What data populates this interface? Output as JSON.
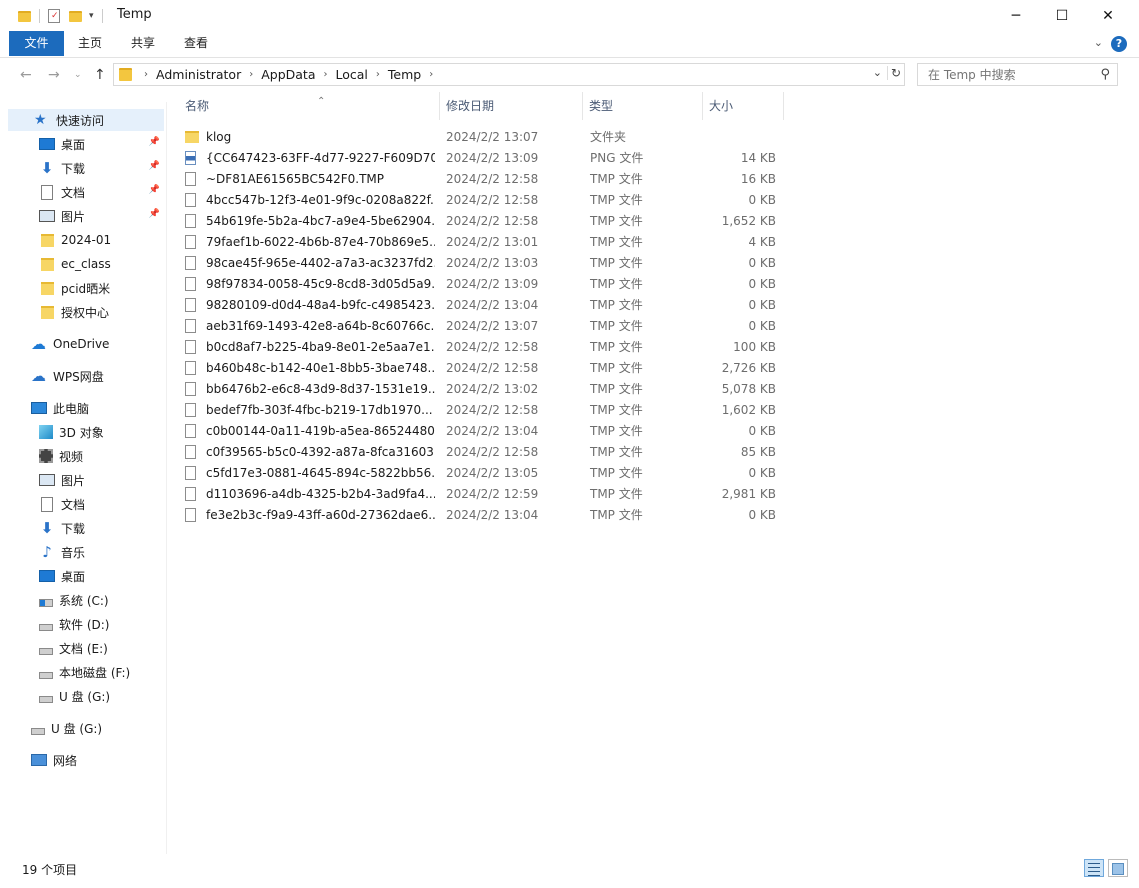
{
  "window": {
    "title": "Temp",
    "controls": {
      "minimize": "─",
      "maximize": "☐",
      "close": "✕"
    }
  },
  "ribbon": {
    "tabs": [
      "文件",
      "主页",
      "共享",
      "查看"
    ],
    "help": "?"
  },
  "address": {
    "crumbs": [
      "Administrator",
      "AppData",
      "Local",
      "Temp"
    ]
  },
  "search": {
    "placeholder": "在 Temp 中搜索"
  },
  "sidebar": {
    "quick_access": "快速访问",
    "quick_items": [
      {
        "label": "桌面",
        "icon": "desktop-icon",
        "pinned": true
      },
      {
        "label": "下载",
        "icon": "download-icon",
        "pinned": true
      },
      {
        "label": "文档",
        "icon": "document-icon",
        "pinned": true
      },
      {
        "label": "图片",
        "icon": "pictures-icon",
        "pinned": true
      },
      {
        "label": "2024-01",
        "icon": "folder-icon",
        "pinned": false
      },
      {
        "label": "ec_class",
        "icon": "folder-icon",
        "pinned": false
      },
      {
        "label": "pcid晒米",
        "icon": "folder-icon",
        "pinned": false
      },
      {
        "label": "授权中心",
        "icon": "folder-icon",
        "pinned": false
      }
    ],
    "onedrive": "OneDrive",
    "wps": "WPS网盘",
    "this_pc": "此电脑",
    "pc_items": [
      {
        "label": "3D 对象",
        "icon": "3d-objects-icon"
      },
      {
        "label": "视频",
        "icon": "video-icon"
      },
      {
        "label": "图片",
        "icon": "pictures-icon"
      },
      {
        "label": "文档",
        "icon": "document-icon"
      },
      {
        "label": "下载",
        "icon": "download-icon"
      },
      {
        "label": "音乐",
        "icon": "music-icon"
      },
      {
        "label": "桌面",
        "icon": "desktop-icon"
      },
      {
        "label": "系统 (C:)",
        "icon": "system-drive-icon"
      },
      {
        "label": "软件 (D:)",
        "icon": "drive-icon"
      },
      {
        "label": "文档 (E:)",
        "icon": "drive-icon"
      },
      {
        "label": "本地磁盘 (F:)",
        "icon": "drive-icon"
      },
      {
        "label": "U 盘 (G:)",
        "icon": "usb-drive-icon"
      }
    ],
    "usb_root": "U 盘 (G:)",
    "network": "网络"
  },
  "columns": {
    "name": "名称",
    "date": "修改日期",
    "type": "类型",
    "size": "大小"
  },
  "files": [
    {
      "name": "klog",
      "date": "2024/2/2 13:07",
      "type": "文件夹",
      "size": "",
      "kind": "folder"
    },
    {
      "name": "{CC647423-63FF-4d77-9227-F609D70...",
      "date": "2024/2/2 13:09",
      "type": "PNG 文件",
      "size": "14 KB",
      "kind": "png"
    },
    {
      "name": "~DF81AE61565BC542F0.TMP",
      "date": "2024/2/2 12:58",
      "type": "TMP 文件",
      "size": "16 KB",
      "kind": "file"
    },
    {
      "name": "4bcc547b-12f3-4e01-9f9c-0208a822f...",
      "date": "2024/2/2 12:58",
      "type": "TMP 文件",
      "size": "0 KB",
      "kind": "file"
    },
    {
      "name": "54b619fe-5b2a-4bc7-a9e4-5be62904...",
      "date": "2024/2/2 12:58",
      "type": "TMP 文件",
      "size": "1,652 KB",
      "kind": "file"
    },
    {
      "name": "79faef1b-6022-4b6b-87e4-70b869e5...",
      "date": "2024/2/2 13:01",
      "type": "TMP 文件",
      "size": "4 KB",
      "kind": "file"
    },
    {
      "name": "98cae45f-965e-4402-a7a3-ac3237fd2...",
      "date": "2024/2/2 13:03",
      "type": "TMP 文件",
      "size": "0 KB",
      "kind": "file"
    },
    {
      "name": "98f97834-0058-45c9-8cd8-3d05d5a9...",
      "date": "2024/2/2 13:09",
      "type": "TMP 文件",
      "size": "0 KB",
      "kind": "file"
    },
    {
      "name": "98280109-d0d4-48a4-b9fc-c4985423...",
      "date": "2024/2/2 13:04",
      "type": "TMP 文件",
      "size": "0 KB",
      "kind": "file"
    },
    {
      "name": "aeb31f69-1493-42e8-a64b-8c60766c...",
      "date": "2024/2/2 13:07",
      "type": "TMP 文件",
      "size": "0 KB",
      "kind": "file"
    },
    {
      "name": "b0cd8af7-b225-4ba9-8e01-2e5aa7e1...",
      "date": "2024/2/2 12:58",
      "type": "TMP 文件",
      "size": "100 KB",
      "kind": "file"
    },
    {
      "name": "b460b48c-b142-40e1-8bb5-3bae748...",
      "date": "2024/2/2 12:58",
      "type": "TMP 文件",
      "size": "2,726 KB",
      "kind": "file"
    },
    {
      "name": "bb6476b2-e6c8-43d9-8d37-1531e19...",
      "date": "2024/2/2 13:02",
      "type": "TMP 文件",
      "size": "5,078 KB",
      "kind": "file"
    },
    {
      "name": "bedef7fb-303f-4fbc-b219-17db1970...",
      "date": "2024/2/2 12:58",
      "type": "TMP 文件",
      "size": "1,602 KB",
      "kind": "file"
    },
    {
      "name": "c0b00144-0a11-419b-a5ea-86524480...",
      "date": "2024/2/2 13:04",
      "type": "TMP 文件",
      "size": "0 KB",
      "kind": "file"
    },
    {
      "name": "c0f39565-b5c0-4392-a87a-8fca31603...",
      "date": "2024/2/2 12:58",
      "type": "TMP 文件",
      "size": "85 KB",
      "kind": "file"
    },
    {
      "name": "c5fd17e3-0881-4645-894c-5822bb56...",
      "date": "2024/2/2 13:05",
      "type": "TMP 文件",
      "size": "0 KB",
      "kind": "file"
    },
    {
      "name": "d1103696-a4db-4325-b2b4-3ad9fa4...",
      "date": "2024/2/2 12:59",
      "type": "TMP 文件",
      "size": "2,981 KB",
      "kind": "file"
    },
    {
      "name": "fe3e2b3c-f9a9-43ff-a60d-27362dae6...",
      "date": "2024/2/2 13:04",
      "type": "TMP 文件",
      "size": "0 KB",
      "kind": "file"
    }
  ],
  "status": {
    "count_text": "19 个项目"
  },
  "colors": {
    "accent": "#1c6bbd",
    "selection": "#e5f0fb",
    "folder": "#f7d665"
  }
}
